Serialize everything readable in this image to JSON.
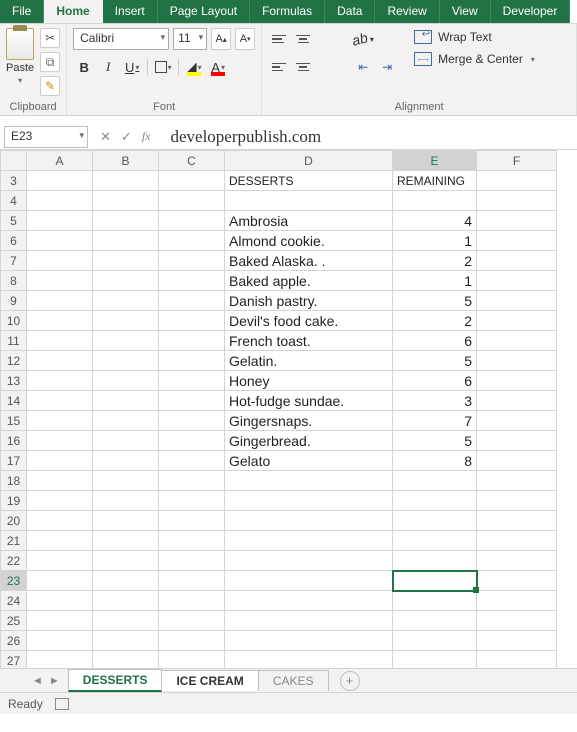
{
  "tabs": {
    "file": "File",
    "home": "Home",
    "insert": "Insert",
    "pagelayout": "Page Layout",
    "formulas": "Formulas",
    "data": "Data",
    "review": "Review",
    "view": "View",
    "developer": "Developer"
  },
  "ribbon": {
    "clipboard": {
      "paste": "Paste",
      "label": "Clipboard"
    },
    "font": {
      "name": "Calibri",
      "size": "11",
      "label": "Font",
      "bold": "B",
      "italic": "I",
      "underline": "U",
      "fontcolor": "A",
      "fill": "🪣"
    },
    "align": {
      "label": "Alignment",
      "wrap": "Wrap Text",
      "merge": "Merge & Center",
      "orient": "ab"
    }
  },
  "fbar": {
    "namebox": "E23",
    "fx": "fx",
    "formula": "developerpublish.com",
    "cancel": "✕",
    "enter": "✓"
  },
  "columns": [
    "A",
    "B",
    "C",
    "D",
    "E",
    "F"
  ],
  "rows": [
    3,
    4,
    5,
    6,
    7,
    8,
    9,
    10,
    11,
    12,
    13,
    14,
    15,
    16,
    17,
    18,
    19,
    20,
    21,
    22,
    23,
    24,
    25,
    26,
    27
  ],
  "headers": {
    "d": "DESSERTS",
    "e": "REMAINING"
  },
  "data": [
    {
      "d": "Ambrosia",
      "e": 4
    },
    {
      "d": "Almond cookie.",
      "e": 1
    },
    {
      "d": "Baked Alaska. .",
      "e": 2
    },
    {
      "d": "Baked apple.",
      "e": 1
    },
    {
      "d": "Danish pastry.",
      "e": 5
    },
    {
      "d": "Devil's food cake.",
      "e": 2
    },
    {
      "d": "French toast.",
      "e": 6
    },
    {
      "d": "Gelatin.",
      "e": 5
    },
    {
      "d": "Honey",
      "e": 6
    },
    {
      "d": "Hot-fudge sundae.",
      "e": 3
    },
    {
      "d": "Gingersnaps.",
      "e": 7
    },
    {
      "d": "Gingerbread.",
      "e": 5
    },
    {
      "d": "Gelato",
      "e": 8
    }
  ],
  "selected": {
    "col": "E",
    "row": 23
  },
  "sheets": {
    "s1": "DESSERTS",
    "s2": "ICE CREAM",
    "s3": "CAKES"
  },
  "status": {
    "ready": "Ready"
  }
}
